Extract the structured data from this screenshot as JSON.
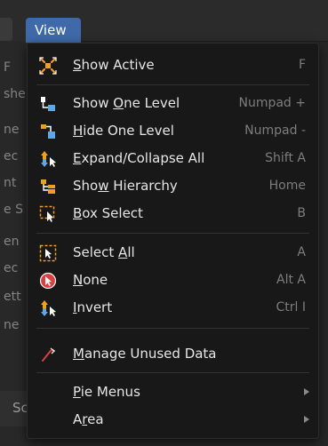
{
  "header": {
    "view_tab": "View"
  },
  "background": {
    "frags": [
      "F",
      "she",
      "ne",
      "ec",
      "nt",
      "e S",
      "en",
      "ec",
      "ett",
      "ne"
    ],
    "scene": "Scene"
  },
  "menu": {
    "items": [
      {
        "pre": "",
        "u": "S",
        "post": "how Active",
        "shortcut": "F",
        "icon": "show-active-icon"
      },
      {
        "pre": "Show ",
        "u": "O",
        "post": "ne Level",
        "shortcut": "Numpad +",
        "icon": "show-one-level-icon"
      },
      {
        "pre": "",
        "u": "H",
        "post": "ide One Level",
        "shortcut": "Numpad -",
        "icon": "hide-one-level-icon"
      },
      {
        "pre": "",
        "u": "E",
        "post": "xpand/Collapse All",
        "shortcut": "Shift A",
        "icon": "expand-collapse-icon"
      },
      {
        "pre": "Sho",
        "u": "w",
        "post": " Hierarchy",
        "shortcut": "Home",
        "icon": "hierarchy-icon"
      },
      {
        "pre": "",
        "u": "B",
        "post": "ox Select",
        "shortcut": "B",
        "icon": "box-select-icon"
      },
      {
        "pre": "Select ",
        "u": "A",
        "post": "ll",
        "shortcut": "A",
        "icon": "select-all-icon"
      },
      {
        "pre": "",
        "u": "N",
        "post": "one",
        "shortcut": "Alt A",
        "icon": "select-none-icon"
      },
      {
        "pre": "",
        "u": "I",
        "post": "nvert",
        "shortcut": "Ctrl I",
        "icon": "invert-icon"
      },
      {
        "pre": "",
        "u": "M",
        "post": "anage Unused Data",
        "shortcut": "",
        "icon": "orphan-data-icon"
      },
      {
        "pre": "",
        "u": "P",
        "post": "ie Menus",
        "shortcut": "",
        "icon": ""
      },
      {
        "pre": "A",
        "u": "r",
        "post": "ea",
        "shortcut": "",
        "icon": ""
      }
    ]
  },
  "colors": {
    "accent": "#3f69a8",
    "menu_bg": "#181818",
    "shortcut": "#7d7d7d",
    "icon_orange": "#f0a020",
    "icon_blue": "#5fa8e8",
    "icon_red": "#d94040"
  }
}
